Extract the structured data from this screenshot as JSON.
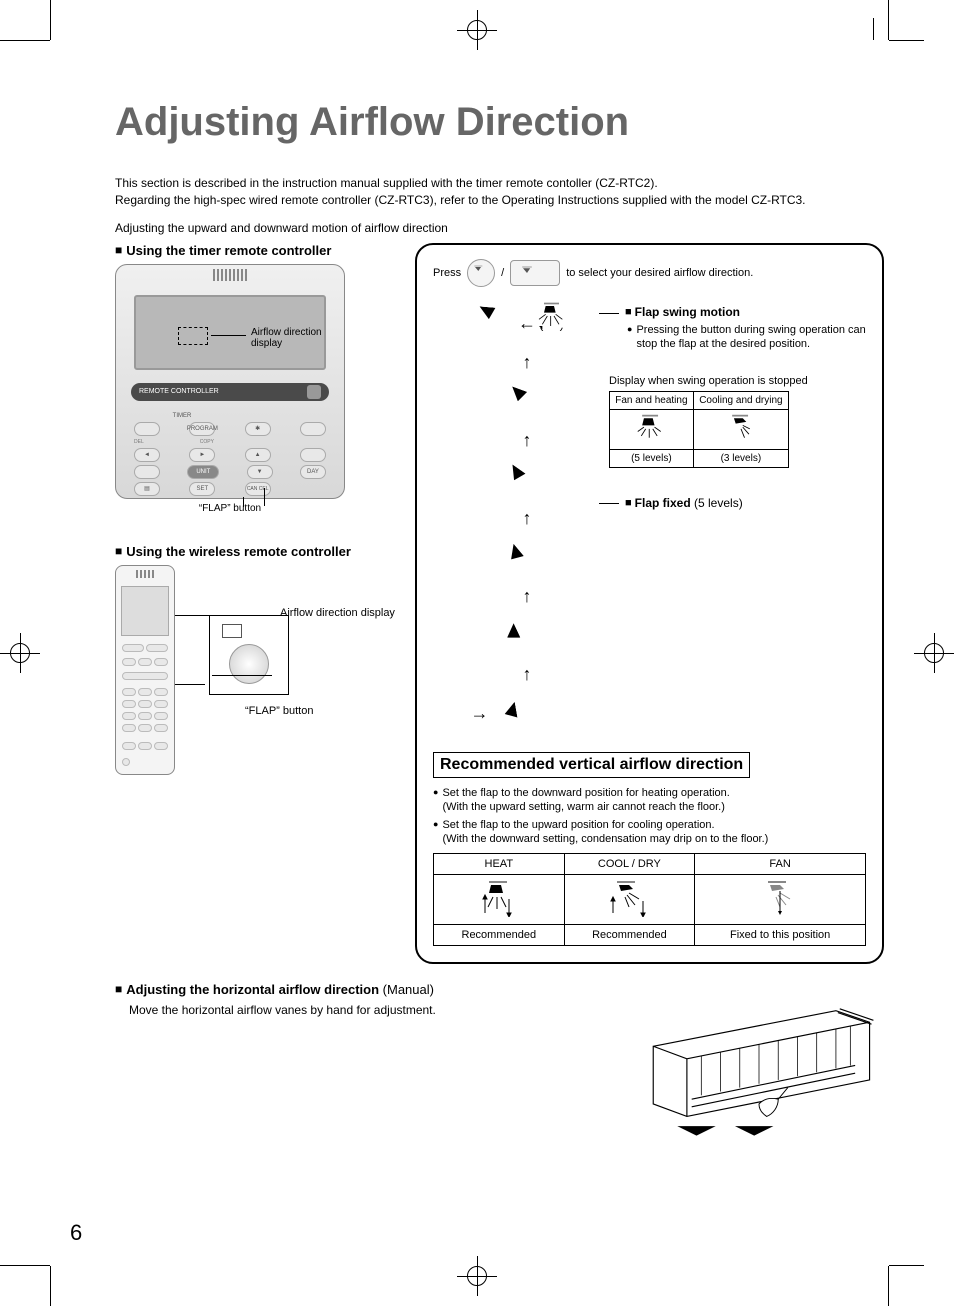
{
  "page_number": "6",
  "title": "Adjusting Airflow Direction",
  "intro_line1": "This section is described in the instruction manual supplied with the timer remote contoller (CZ-RTC2).",
  "intro_line2": "Regarding the high-spec wired remote controller (CZ-RTC3), refer to the Operating Instructions supplied with the model CZ-RTC3.",
  "sub_line": "Adjusting the upward and downward motion of airflow direction",
  "sections": {
    "timer": {
      "heading": "Using the timer remote controller",
      "screen_label": "Airflow direction display",
      "bar_label": "REMOTE CONTROLLER",
      "timer_label": "TIMER",
      "program_label": "PROGRAM",
      "copy_label": "COPY",
      "unit_label": "UNIT",
      "set_label": "SET",
      "cancel_label": "CAN CEL",
      "day_label": "DAY",
      "del_label": "DEL",
      "flap_caption": "“FLAP” button"
    },
    "wireless": {
      "heading": "Using the wireless remote controller",
      "label1": "Airflow direction display",
      "flap_caption": "“FLAP” button"
    }
  },
  "right": {
    "press_prefix": "Press",
    "press_sep": "/",
    "press_suffix": "to select your desired airflow direction.",
    "swing": {
      "heading": "Flap swing motion",
      "bullet": "Pressing the button during swing operation can stop the flap at the desired position.",
      "stopped_label": "Display when swing operation is stopped",
      "col1_h": "Fan and heating",
      "col2_h": "Cooling and drying",
      "col1_f": "(5 levels)",
      "col2_f": "(3 levels)"
    },
    "fixed": {
      "heading_bold": "Flap fixed",
      "heading_rest": "(5 levels)"
    },
    "rec": {
      "heading": "Recommended vertical airflow direction",
      "b1a": "Set the flap to the downward position for heating operation.",
      "b1b": "(With the upward setting, warm air cannot reach the floor.)",
      "b2a": "Set the flap to the upward position for cooling operation.",
      "b2b": "(With the downward setting, condensation may drip on to the floor.)",
      "th1": "HEAT",
      "th2": "COOL / DRY",
      "th3": "FAN",
      "td1": "Recommended",
      "td2": "Recommended",
      "td3": "Fixed to this position"
    }
  },
  "horiz": {
    "heading_bold": "Adjusting the horizontal airflow direction",
    "heading_rest": "(Manual)",
    "text": "Move the horizontal airflow vanes by hand for adjustment."
  }
}
